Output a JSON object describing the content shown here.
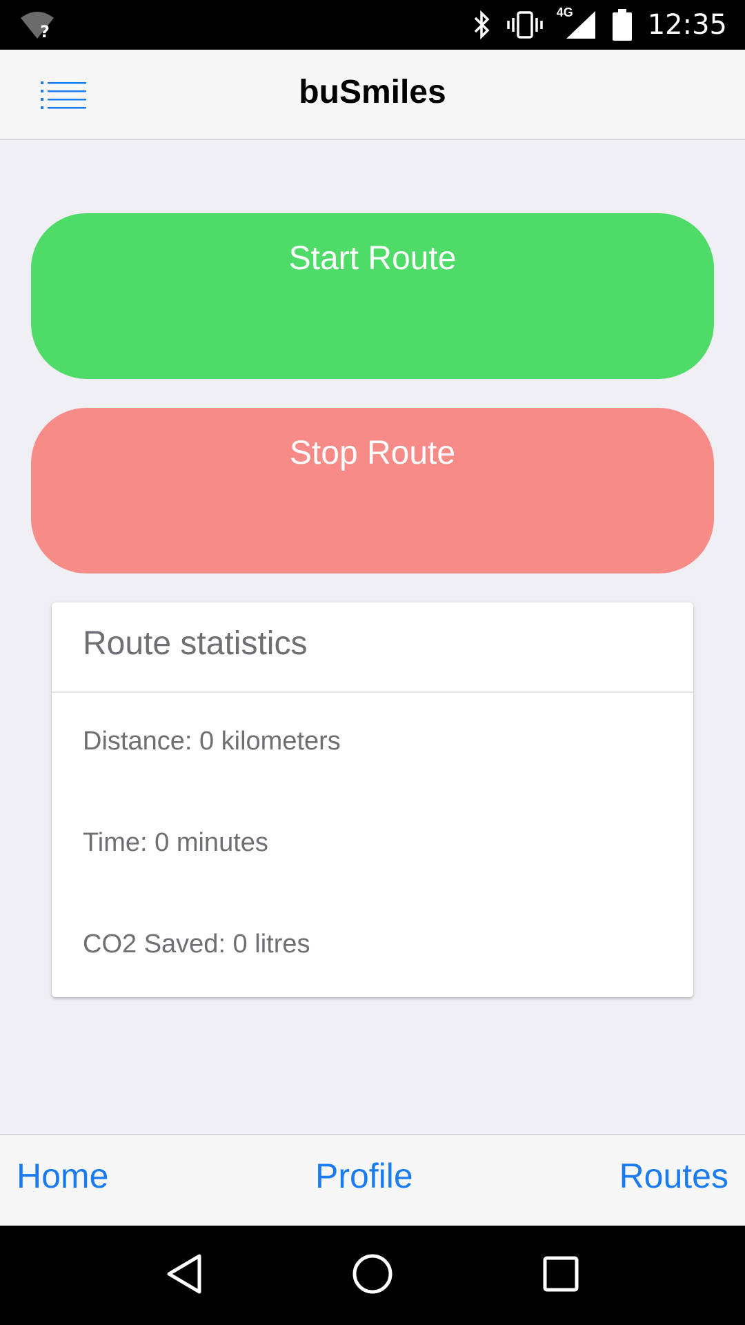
{
  "status_bar": {
    "time": "12:35",
    "network_label": "4G",
    "icons": [
      "wifi-unknown-icon",
      "bluetooth-icon",
      "vibrate-icon",
      "signal-icon",
      "battery-icon"
    ]
  },
  "header": {
    "title": "buSmiles",
    "menu_icon": "list-menu-icon"
  },
  "actions": {
    "start_label": "Start Route",
    "stop_label": "Stop Route"
  },
  "stats": {
    "title": "Route statistics",
    "distance": "Distance: 0 kilometers",
    "time": "Time: 0 minutes",
    "co2": "CO2 Saved: 0 litres"
  },
  "tabs": [
    {
      "label": "Home"
    },
    {
      "label": "Profile"
    },
    {
      "label": "Routes"
    }
  ],
  "colors": {
    "accent": "#1a7cf0",
    "start": "#4fdb68",
    "stop": "#f78b88",
    "background": "#efeff4"
  },
  "nav_bar": {
    "icons": [
      "back-icon",
      "home-circle-icon",
      "recents-icon"
    ]
  }
}
